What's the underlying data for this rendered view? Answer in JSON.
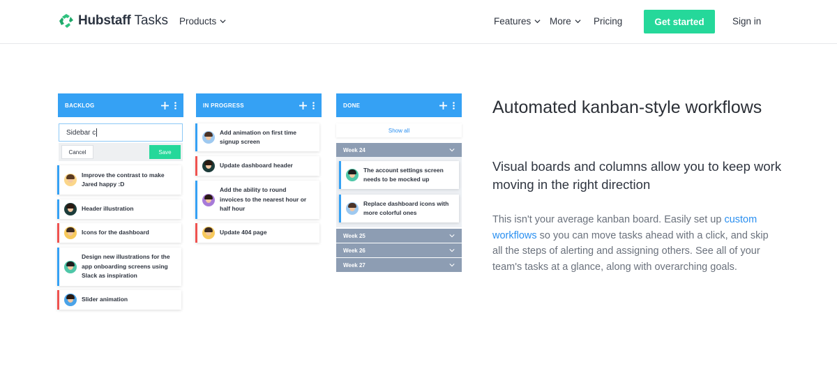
{
  "header": {
    "brand": "Hubstaff",
    "product": "Tasks",
    "nav_left": [
      {
        "label": "Products"
      }
    ],
    "nav_right": [
      {
        "label": "Features"
      },
      {
        "label": "More"
      },
      {
        "label": "Pricing"
      }
    ],
    "cta_label": "Get started",
    "signin_label": "Sign in",
    "brand_color": "#25d89a"
  },
  "board": {
    "accent": "#35a1f4",
    "columns": [
      {
        "title": "BACKLOG",
        "new_card_value": "Sidebar c",
        "cancel_label": "Cancel",
        "save_label": "Save",
        "cards": [
          {
            "text": "Improve the contrast to make Jared happy :D",
            "color": "blue"
          },
          {
            "text": "Header illustration",
            "color": "blue"
          },
          {
            "text": "Icons for the dashboard",
            "color": "red"
          },
          {
            "text": "Design new illustrations for the app onboarding screens using Slack as inspiration",
            "color": "blue"
          },
          {
            "text": "Slider animation",
            "color": "red"
          }
        ]
      },
      {
        "title": "IN PROGRESS",
        "cards": [
          {
            "text": "Add animation on first time signup screen",
            "color": "blue"
          },
          {
            "text": "Update dashboard header",
            "color": "red"
          },
          {
            "text": "Add the ability to round invoices to the nearest hour or half hour",
            "color": "blue"
          },
          {
            "text": "Update 404 page",
            "color": "red"
          }
        ]
      },
      {
        "title": "DONE",
        "show_all_label": "Show all",
        "weeks": [
          {
            "label": "Week 24",
            "cards": [
              {
                "text": "The account settings screen needs to be mocked up",
                "color": "blue"
              },
              {
                "text": "Replace dashboard icons with more colorful ones",
                "color": "blue"
              }
            ]
          },
          {
            "label": "Week 25"
          },
          {
            "label": "Week 26"
          },
          {
            "label": "Week 27"
          }
        ]
      }
    ]
  },
  "feature": {
    "heading": "Automated kanban-style workflows",
    "subheading": "Visual boards and columns allow you to keep work moving in the right direction",
    "para_before": "This isn't your average kanban board. Easily set up ",
    "para_link": "custom workflows",
    "para_after": " so you can move tasks ahead with a click, and skip all the steps of alerting and assigning others. See all of your team's tasks at a glance, along with overarching goals."
  }
}
